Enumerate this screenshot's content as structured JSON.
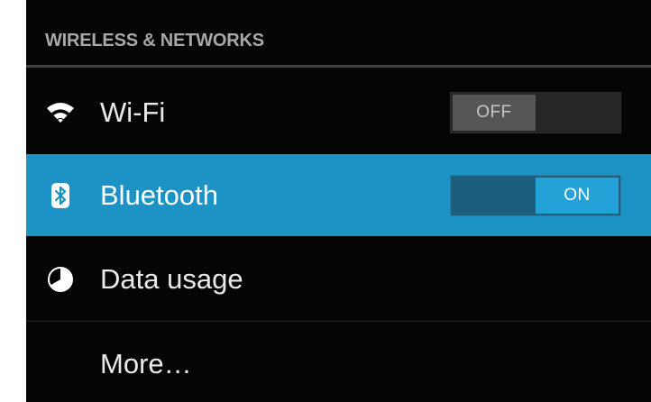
{
  "section": {
    "title": "WIRELESS & NETWORKS"
  },
  "items": [
    {
      "label": "Wi-Fi",
      "icon": "wifi-icon",
      "toggle": "OFF"
    },
    {
      "label": "Bluetooth",
      "icon": "bluetooth-icon",
      "toggle": "ON",
      "selected": true
    },
    {
      "label": "Data usage",
      "icon": "data-usage-icon"
    },
    {
      "label": "More…"
    }
  ],
  "colors": {
    "background": "#050505",
    "highlight": "#1c93c4",
    "toggle_on": "#22a2d6",
    "toggle_off": "#565656",
    "header_text": "#a8a8a8"
  }
}
